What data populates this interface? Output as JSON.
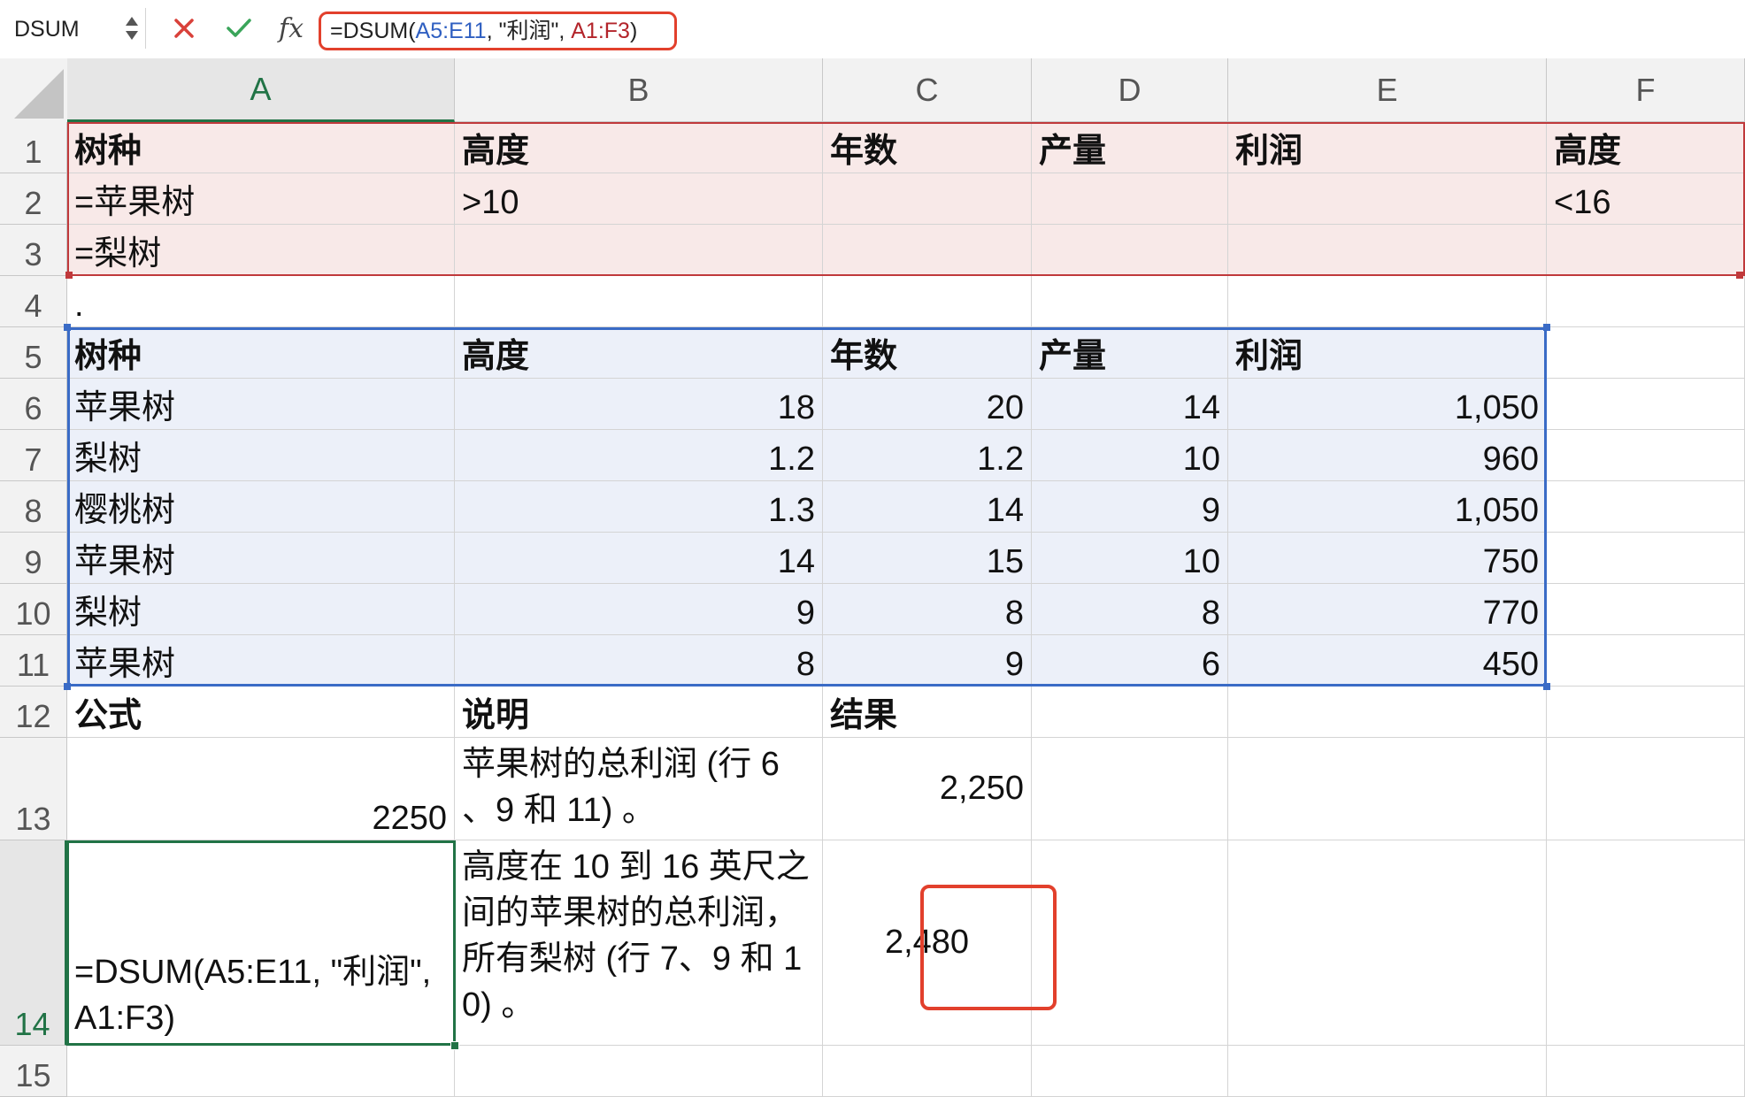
{
  "formula_bar": {
    "name_box": "DSUM",
    "formula_prefix": "=DSUM(",
    "formula_ref1": "A5:E11",
    "formula_mid": ", \"利润\", ",
    "formula_ref2": "A1:F3",
    "formula_suffix": ")",
    "fx_label": "fx"
  },
  "columns": [
    "A",
    "B",
    "C",
    "D",
    "E",
    "F"
  ],
  "rows": [
    "1",
    "2",
    "3",
    "4",
    "5",
    "6",
    "7",
    "8",
    "9",
    "10",
    "11",
    "12",
    "13",
    "14",
    "15"
  ],
  "cells": {
    "A1": "树种",
    "B1": "高度",
    "C1": "年数",
    "D1": "产量",
    "E1": "利润",
    "F1": "高度",
    "A2": "=苹果树",
    "B2": ">10",
    "F2": "<16",
    "A3": "=梨树",
    "A4": ".",
    "A5": "树种",
    "B5": "高度",
    "C5": "年数",
    "D5": "产量",
    "E5": "利润",
    "A6": "苹果树",
    "B6": "18",
    "C6": "20",
    "D6": "14",
    "E6": "1,050",
    "A7": "梨树",
    "B7": "1.2",
    "C7": "1.2",
    "D7": "10",
    "E7": "960",
    "A8": "樱桃树",
    "B8": "1.3",
    "C8": "14",
    "D8": "9",
    "E8": "1,050",
    "A9": "苹果树",
    "B9": "14",
    "C9": "15",
    "D9": "10",
    "E9": "750",
    "A10": "梨树",
    "B10": "9",
    "C10": "8",
    "D10": "8",
    "E10": "770",
    "A11": "苹果树",
    "B11": "8",
    "C11": "9",
    "D11": "6",
    "E11": "450",
    "A12": "公式",
    "B12": "说明",
    "C12": "结果",
    "A13": "2250",
    "B13": "苹果树的总利润 (行 6 、9 和 11) 。",
    "C13": "2,250",
    "A14": "=DSUM(A5:E11, \"利润\", A1:F3)",
    "B14": "高度在 10 到 16 英尺之间的苹果树的总利润，所有梨树 (行 7、9 和 10) 。",
    "C14": "2,480"
  },
  "selected_cell": "A14",
  "colors": {
    "criteria_fill": "#f8e9e8",
    "criteria_border": "#c0393b",
    "database_fill": "#ecf0f9",
    "database_border": "#3a6bc6",
    "selection": "#217346",
    "callout": "#e2402c"
  }
}
